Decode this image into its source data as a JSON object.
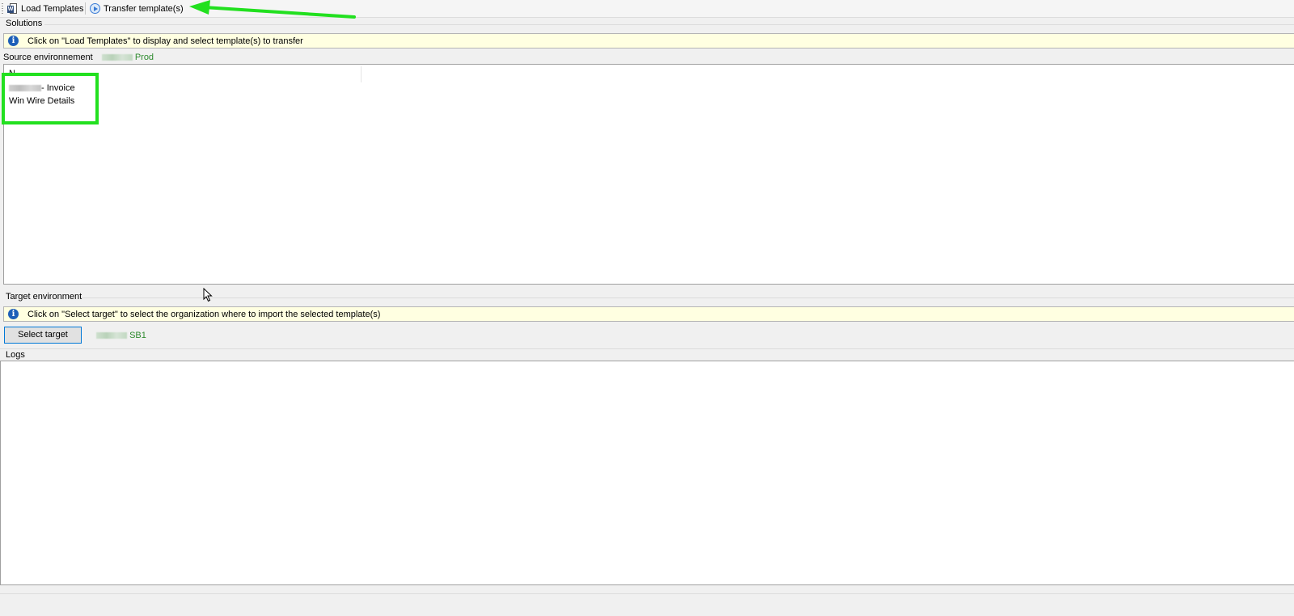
{
  "toolbar": {
    "load_templates_label": "Load Templates",
    "transfer_templates_label": "Transfer template(s)"
  },
  "solutions": {
    "section_label": "Solutions",
    "info_message": "Click on \"Load Templates\" to display and select template(s) to transfer",
    "source_label": "Source environnement",
    "source_value": "Prod",
    "column_header": "N",
    "items": [
      {
        "label": "- Invoice"
      },
      {
        "label": "Win Wire Details"
      }
    ]
  },
  "target": {
    "section_label": "Target environment",
    "info_message": "Click on \"Select target\" to select the organization where to import the selected template(s)",
    "select_button_label": "Select target",
    "target_value": "SB1"
  },
  "logs": {
    "section_label": "Logs"
  },
  "colors": {
    "annotation_green": "#22e01f",
    "info_bar_bg": "#ffffe1",
    "env_text_green": "#2e8b2e"
  }
}
